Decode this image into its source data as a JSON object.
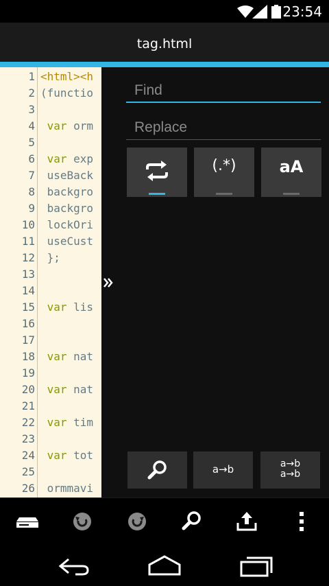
{
  "status": {
    "time": "23:54"
  },
  "title_bar": {
    "title": "tag.html"
  },
  "editor": {
    "lines": [
      {
        "n": "1",
        "segments": [
          {
            "t": "<html><h",
            "c": "tag"
          }
        ]
      },
      {
        "n": "2",
        "segments": [
          {
            "t": "(functio",
            "c": ""
          }
        ]
      },
      {
        "n": "3",
        "segments": []
      },
      {
        "n": "4",
        "segments": [
          {
            "t": " var",
            "c": "kw"
          },
          {
            "t": " orm",
            "c": ""
          }
        ]
      },
      {
        "n": "5",
        "segments": []
      },
      {
        "n": "6",
        "segments": [
          {
            "t": " var",
            "c": "kw"
          },
          {
            "t": " exp",
            "c": ""
          }
        ]
      },
      {
        "n": "7",
        "segments": [
          {
            "t": " useBack",
            "c": ""
          }
        ]
      },
      {
        "n": "8",
        "segments": [
          {
            "t": " backgro",
            "c": ""
          }
        ]
      },
      {
        "n": "9",
        "segments": [
          {
            "t": " backgro",
            "c": ""
          }
        ]
      },
      {
        "n": "10",
        "segments": [
          {
            "t": " lockOri",
            "c": ""
          }
        ]
      },
      {
        "n": "11",
        "segments": [
          {
            "t": " useCust",
            "c": ""
          }
        ]
      },
      {
        "n": "12",
        "segments": [
          {
            "t": " };",
            "c": ""
          }
        ]
      },
      {
        "n": "13",
        "segments": []
      },
      {
        "n": "14",
        "segments": []
      },
      {
        "n": "15",
        "segments": [
          {
            "t": " var",
            "c": "kw"
          },
          {
            "t": " lis",
            "c": ""
          }
        ]
      },
      {
        "n": "16",
        "segments": []
      },
      {
        "n": "17",
        "segments": []
      },
      {
        "n": "18",
        "segments": [
          {
            "t": " var",
            "c": "kw"
          },
          {
            "t": " nat",
            "c": ""
          }
        ]
      },
      {
        "n": "19",
        "segments": []
      },
      {
        "n": "20",
        "segments": [
          {
            "t": " var",
            "c": "kw"
          },
          {
            "t": " nat",
            "c": ""
          }
        ]
      },
      {
        "n": "21",
        "segments": []
      },
      {
        "n": "22",
        "segments": [
          {
            "t": " var",
            "c": "kw"
          },
          {
            "t": " tim",
            "c": ""
          }
        ]
      },
      {
        "n": "23",
        "segments": []
      },
      {
        "n": "24",
        "segments": [
          {
            "t": " var",
            "c": "kw"
          },
          {
            "t": " tot",
            "c": ""
          }
        ]
      },
      {
        "n": "25",
        "segments": []
      },
      {
        "n": "26",
        "segments": [
          {
            "t": " ormmavi",
            "c": ""
          }
        ]
      }
    ]
  },
  "find_panel": {
    "find_placeholder": "Find",
    "replace_placeholder": "Replace",
    "toggles": {
      "regex_label": "(.*)",
      "case_label": "aA"
    },
    "actions": {
      "replace_label": "a→b",
      "replace_all_line1": "a→b",
      "replace_all_line2": "a→b"
    }
  },
  "colors": {
    "accent": "#33b5e5",
    "editor_bg": "#fdf6e3",
    "keyword": "#859900",
    "tag": "#b58900"
  }
}
